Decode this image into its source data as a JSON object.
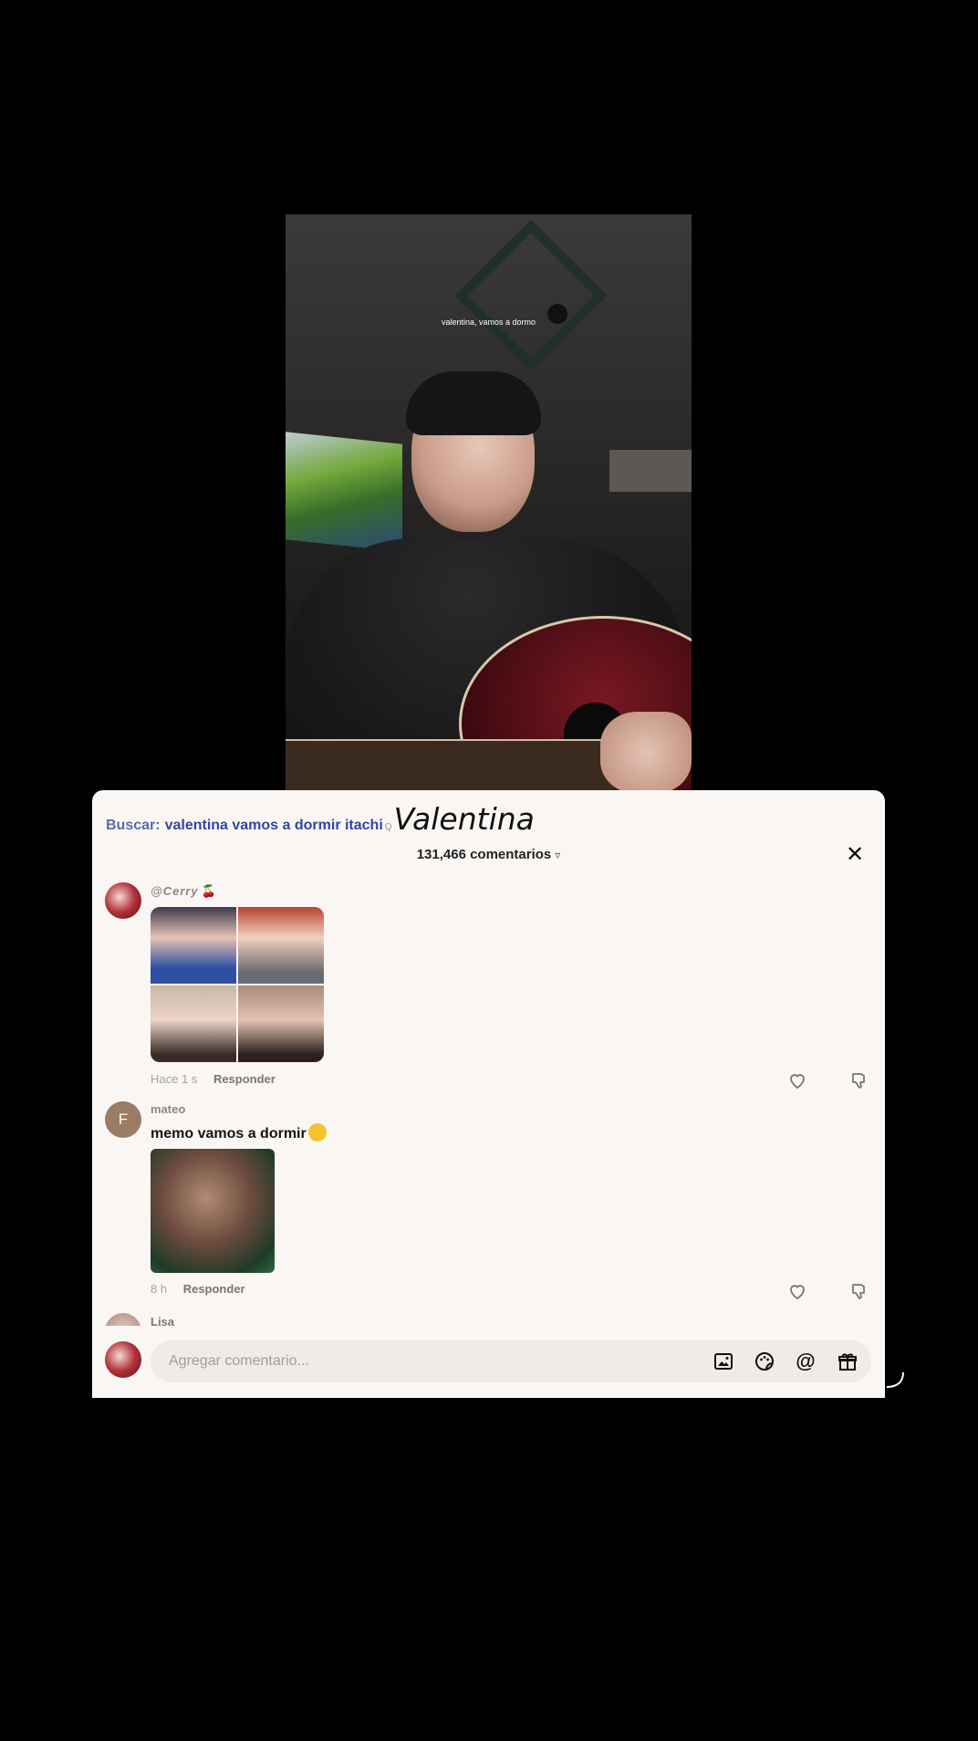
{
  "video": {
    "caption": "valentina, vamos a dormo"
  },
  "search": {
    "label": "Buscar:",
    "query": "valentina vamos a dormir itachi",
    "q_icon": "Q",
    "overlay_text": "Valentina"
  },
  "comments_header": {
    "count_text": "131,466 comentarios",
    "filter_icon": "filter-icon",
    "close_icon": "close-icon"
  },
  "comments": [
    {
      "username": "@Cerry",
      "username_emoji": "🍒",
      "media": "photo-grid",
      "time": "Hace 1 s",
      "reply_label": "Responder"
    },
    {
      "avatar_letter": "F",
      "username": "mateo",
      "text": "memo vamos a dormir",
      "media": "photo",
      "time": "8 h",
      "reply_label": "Responder"
    },
    {
      "username": "Lisa"
    }
  ],
  "composer": {
    "placeholder": "Agregar comentario...",
    "icons": [
      "image-icon",
      "sticker-icon",
      "at-icon",
      "gift-icon"
    ],
    "at_glyph": "@"
  },
  "colors": {
    "panel_bg": "#faf6f3",
    "search_link": "#3346a6",
    "background": "#000000"
  }
}
